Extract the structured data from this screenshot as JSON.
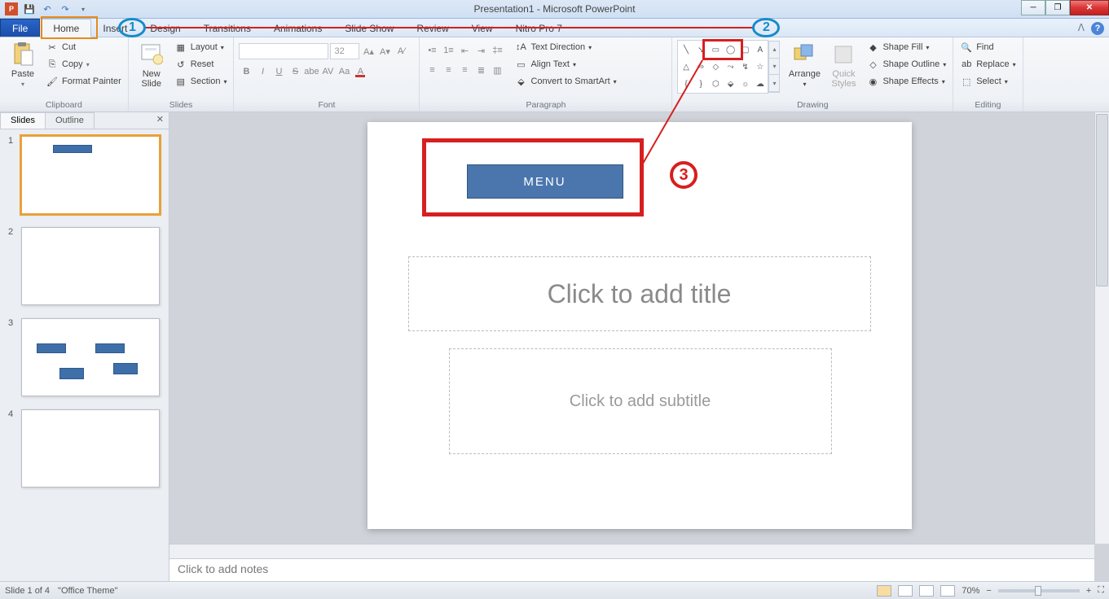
{
  "window": {
    "title": "Presentation1 - Microsoft PowerPoint"
  },
  "qat": {
    "save": "💾",
    "undo": "↶",
    "redo": "↷"
  },
  "tabs": {
    "file": "File",
    "home": "Home",
    "insert": "Insert",
    "design": "Design",
    "transitions": "Transitions",
    "animations": "Animations",
    "slideshow": "Slide Show",
    "review": "Review",
    "view": "View",
    "nitro": "Nitro Pro 7"
  },
  "ribbon": {
    "clipboard": {
      "label": "Clipboard",
      "paste": "Paste",
      "cut": "Cut",
      "copy": "Copy",
      "format_painter": "Format Painter"
    },
    "slides": {
      "label": "Slides",
      "new_slide": "New\nSlide",
      "layout": "Layout",
      "reset": "Reset",
      "section": "Section"
    },
    "font": {
      "label": "Font",
      "size": "32"
    },
    "paragraph": {
      "label": "Paragraph",
      "text_direction": "Text Direction",
      "align_text": "Align Text",
      "convert": "Convert to SmartArt"
    },
    "drawing": {
      "label": "Drawing",
      "arrange": "Arrange",
      "quick_styles": "Quick\nStyles",
      "shape_fill": "Shape Fill",
      "shape_outline": "Shape Outline",
      "shape_effects": "Shape Effects"
    },
    "editing": {
      "label": "Editing",
      "find": "Find",
      "replace": "Replace",
      "select": "Select"
    }
  },
  "panel": {
    "slides_tab": "Slides",
    "outline_tab": "Outline"
  },
  "slide": {
    "menu_text": "MENU",
    "title_placeholder": "Click to add title",
    "subtitle_placeholder": "Click to add subtitle"
  },
  "notes": {
    "placeholder": "Click to add notes"
  },
  "status": {
    "slide_info": "Slide 1 of 4",
    "theme": "\"Office Theme\"",
    "zoom": "70%"
  },
  "annotations": {
    "n1": "1",
    "n2": "2",
    "n3": "3"
  },
  "thumbs": [
    "1",
    "2",
    "3",
    "4"
  ]
}
